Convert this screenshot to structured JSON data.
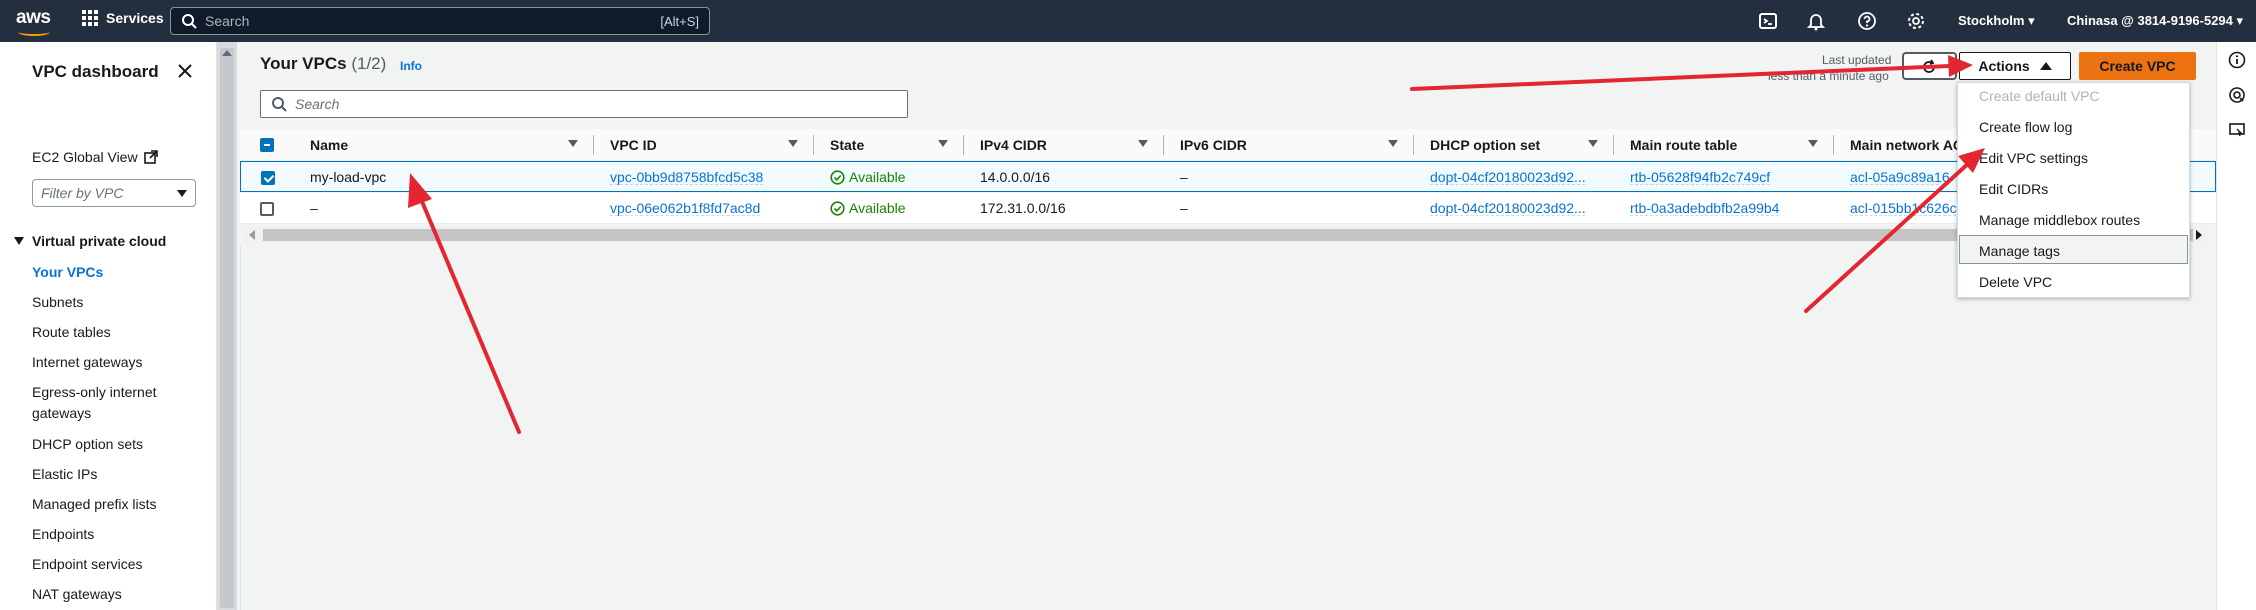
{
  "topnav": {
    "logo_text": "aws",
    "services_label": "Services",
    "search_placeholder": "Search",
    "search_shortcut": "[Alt+S]",
    "region": "Stockholm",
    "account": "Chinasa @ 3814-9196-5294"
  },
  "sidebar": {
    "title": "VPC dashboard",
    "ec2_global_view": "EC2 Global View",
    "filter_placeholder": "Filter by VPC",
    "section": "Virtual private cloud",
    "items": [
      {
        "label": "Your VPCs",
        "active": true
      },
      {
        "label": "Subnets"
      },
      {
        "label": "Route tables"
      },
      {
        "label": "Internet gateways"
      },
      {
        "label": "Egress-only internet gateways"
      },
      {
        "label": "DHCP option sets"
      },
      {
        "label": "Elastic IPs"
      },
      {
        "label": "Managed prefix lists"
      },
      {
        "label": "Endpoints"
      },
      {
        "label": "Endpoint services"
      },
      {
        "label": "NAT gateways"
      }
    ]
  },
  "main": {
    "title": "Your VPCs",
    "count": "(1/2)",
    "info": "Info",
    "last_updated": "Last updated",
    "last_updated_ago": "less than a minute ago",
    "actions_label": "Actions",
    "create_label": "Create VPC",
    "search_placeholder": "Search"
  },
  "table": {
    "columns": [
      "Name",
      "VPC ID",
      "State",
      "IPv4 CIDR",
      "IPv6 CIDR",
      "DHCP option set",
      "Main route table",
      "Main network AC"
    ],
    "rows": [
      {
        "selected": true,
        "name": "my-load-vpc",
        "vpc_id": "vpc-0bb9d8758bfcd5c38",
        "state": "Available",
        "ipv4": "14.0.0.0/16",
        "ipv6": "–",
        "dhcp": "dopt-04cf20180023d92...",
        "route_table": "rtb-05628f94fb2c749cf",
        "nacl": "acl-05a9c89a16"
      },
      {
        "selected": false,
        "name": "–",
        "vpc_id": "vpc-06e062b1f8fd7ac8d",
        "state": "Available",
        "ipv4": "172.31.0.0/16",
        "ipv6": "–",
        "dhcp": "dopt-04cf20180023d92...",
        "route_table": "rtb-0a3adebdbfb2a99b4",
        "nacl": "acl-015bb1c626c"
      }
    ]
  },
  "actions_menu": {
    "items": [
      {
        "label": "Create default VPC",
        "disabled": true
      },
      {
        "label": "Create flow log"
      },
      {
        "label": "Edit VPC settings"
      },
      {
        "label": "Edit CIDRs"
      },
      {
        "label": "Manage middlebox routes"
      },
      {
        "label": "Manage tags",
        "hovered": true
      },
      {
        "label": "Delete VPC"
      }
    ]
  },
  "colors": {
    "nav_bg": "#232f3e",
    "accent_blue": "#0972d3",
    "create_orange": "#ec7211",
    "available_green": "#1d8102",
    "annotation_red": "#e3262f"
  }
}
